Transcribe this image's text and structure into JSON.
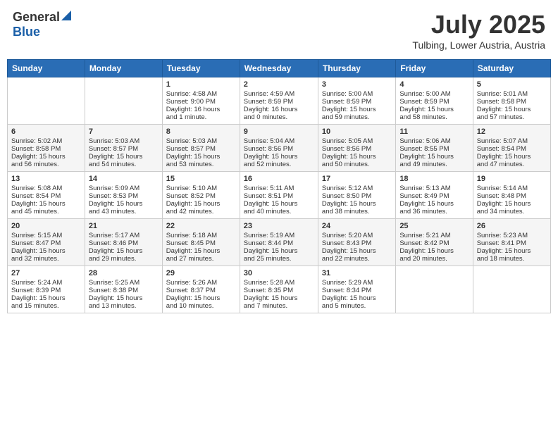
{
  "header": {
    "logo_general": "General",
    "logo_blue": "Blue",
    "month": "July 2025",
    "location": "Tulbing, Lower Austria, Austria"
  },
  "days_of_week": [
    "Sunday",
    "Monday",
    "Tuesday",
    "Wednesday",
    "Thursday",
    "Friday",
    "Saturday"
  ],
  "weeks": [
    [
      {
        "day": "",
        "info": ""
      },
      {
        "day": "",
        "info": ""
      },
      {
        "day": "1",
        "info": "Sunrise: 4:58 AM\nSunset: 9:00 PM\nDaylight: 16 hours\nand 1 minute."
      },
      {
        "day": "2",
        "info": "Sunrise: 4:59 AM\nSunset: 8:59 PM\nDaylight: 16 hours\nand 0 minutes."
      },
      {
        "day": "3",
        "info": "Sunrise: 5:00 AM\nSunset: 8:59 PM\nDaylight: 15 hours\nand 59 minutes."
      },
      {
        "day": "4",
        "info": "Sunrise: 5:00 AM\nSunset: 8:59 PM\nDaylight: 15 hours\nand 58 minutes."
      },
      {
        "day": "5",
        "info": "Sunrise: 5:01 AM\nSunset: 8:58 PM\nDaylight: 15 hours\nand 57 minutes."
      }
    ],
    [
      {
        "day": "6",
        "info": "Sunrise: 5:02 AM\nSunset: 8:58 PM\nDaylight: 15 hours\nand 56 minutes."
      },
      {
        "day": "7",
        "info": "Sunrise: 5:03 AM\nSunset: 8:57 PM\nDaylight: 15 hours\nand 54 minutes."
      },
      {
        "day": "8",
        "info": "Sunrise: 5:03 AM\nSunset: 8:57 PM\nDaylight: 15 hours\nand 53 minutes."
      },
      {
        "day": "9",
        "info": "Sunrise: 5:04 AM\nSunset: 8:56 PM\nDaylight: 15 hours\nand 52 minutes."
      },
      {
        "day": "10",
        "info": "Sunrise: 5:05 AM\nSunset: 8:56 PM\nDaylight: 15 hours\nand 50 minutes."
      },
      {
        "day": "11",
        "info": "Sunrise: 5:06 AM\nSunset: 8:55 PM\nDaylight: 15 hours\nand 49 minutes."
      },
      {
        "day": "12",
        "info": "Sunrise: 5:07 AM\nSunset: 8:54 PM\nDaylight: 15 hours\nand 47 minutes."
      }
    ],
    [
      {
        "day": "13",
        "info": "Sunrise: 5:08 AM\nSunset: 8:54 PM\nDaylight: 15 hours\nand 45 minutes."
      },
      {
        "day": "14",
        "info": "Sunrise: 5:09 AM\nSunset: 8:53 PM\nDaylight: 15 hours\nand 43 minutes."
      },
      {
        "day": "15",
        "info": "Sunrise: 5:10 AM\nSunset: 8:52 PM\nDaylight: 15 hours\nand 42 minutes."
      },
      {
        "day": "16",
        "info": "Sunrise: 5:11 AM\nSunset: 8:51 PM\nDaylight: 15 hours\nand 40 minutes."
      },
      {
        "day": "17",
        "info": "Sunrise: 5:12 AM\nSunset: 8:50 PM\nDaylight: 15 hours\nand 38 minutes."
      },
      {
        "day": "18",
        "info": "Sunrise: 5:13 AM\nSunset: 8:49 PM\nDaylight: 15 hours\nand 36 minutes."
      },
      {
        "day": "19",
        "info": "Sunrise: 5:14 AM\nSunset: 8:48 PM\nDaylight: 15 hours\nand 34 minutes."
      }
    ],
    [
      {
        "day": "20",
        "info": "Sunrise: 5:15 AM\nSunset: 8:47 PM\nDaylight: 15 hours\nand 32 minutes."
      },
      {
        "day": "21",
        "info": "Sunrise: 5:17 AM\nSunset: 8:46 PM\nDaylight: 15 hours\nand 29 minutes."
      },
      {
        "day": "22",
        "info": "Sunrise: 5:18 AM\nSunset: 8:45 PM\nDaylight: 15 hours\nand 27 minutes."
      },
      {
        "day": "23",
        "info": "Sunrise: 5:19 AM\nSunset: 8:44 PM\nDaylight: 15 hours\nand 25 minutes."
      },
      {
        "day": "24",
        "info": "Sunrise: 5:20 AM\nSunset: 8:43 PM\nDaylight: 15 hours\nand 22 minutes."
      },
      {
        "day": "25",
        "info": "Sunrise: 5:21 AM\nSunset: 8:42 PM\nDaylight: 15 hours\nand 20 minutes."
      },
      {
        "day": "26",
        "info": "Sunrise: 5:23 AM\nSunset: 8:41 PM\nDaylight: 15 hours\nand 18 minutes."
      }
    ],
    [
      {
        "day": "27",
        "info": "Sunrise: 5:24 AM\nSunset: 8:39 PM\nDaylight: 15 hours\nand 15 minutes."
      },
      {
        "day": "28",
        "info": "Sunrise: 5:25 AM\nSunset: 8:38 PM\nDaylight: 15 hours\nand 13 minutes."
      },
      {
        "day": "29",
        "info": "Sunrise: 5:26 AM\nSunset: 8:37 PM\nDaylight: 15 hours\nand 10 minutes."
      },
      {
        "day": "30",
        "info": "Sunrise: 5:28 AM\nSunset: 8:35 PM\nDaylight: 15 hours\nand 7 minutes."
      },
      {
        "day": "31",
        "info": "Sunrise: 5:29 AM\nSunset: 8:34 PM\nDaylight: 15 hours\nand 5 minutes."
      },
      {
        "day": "",
        "info": ""
      },
      {
        "day": "",
        "info": ""
      }
    ]
  ]
}
